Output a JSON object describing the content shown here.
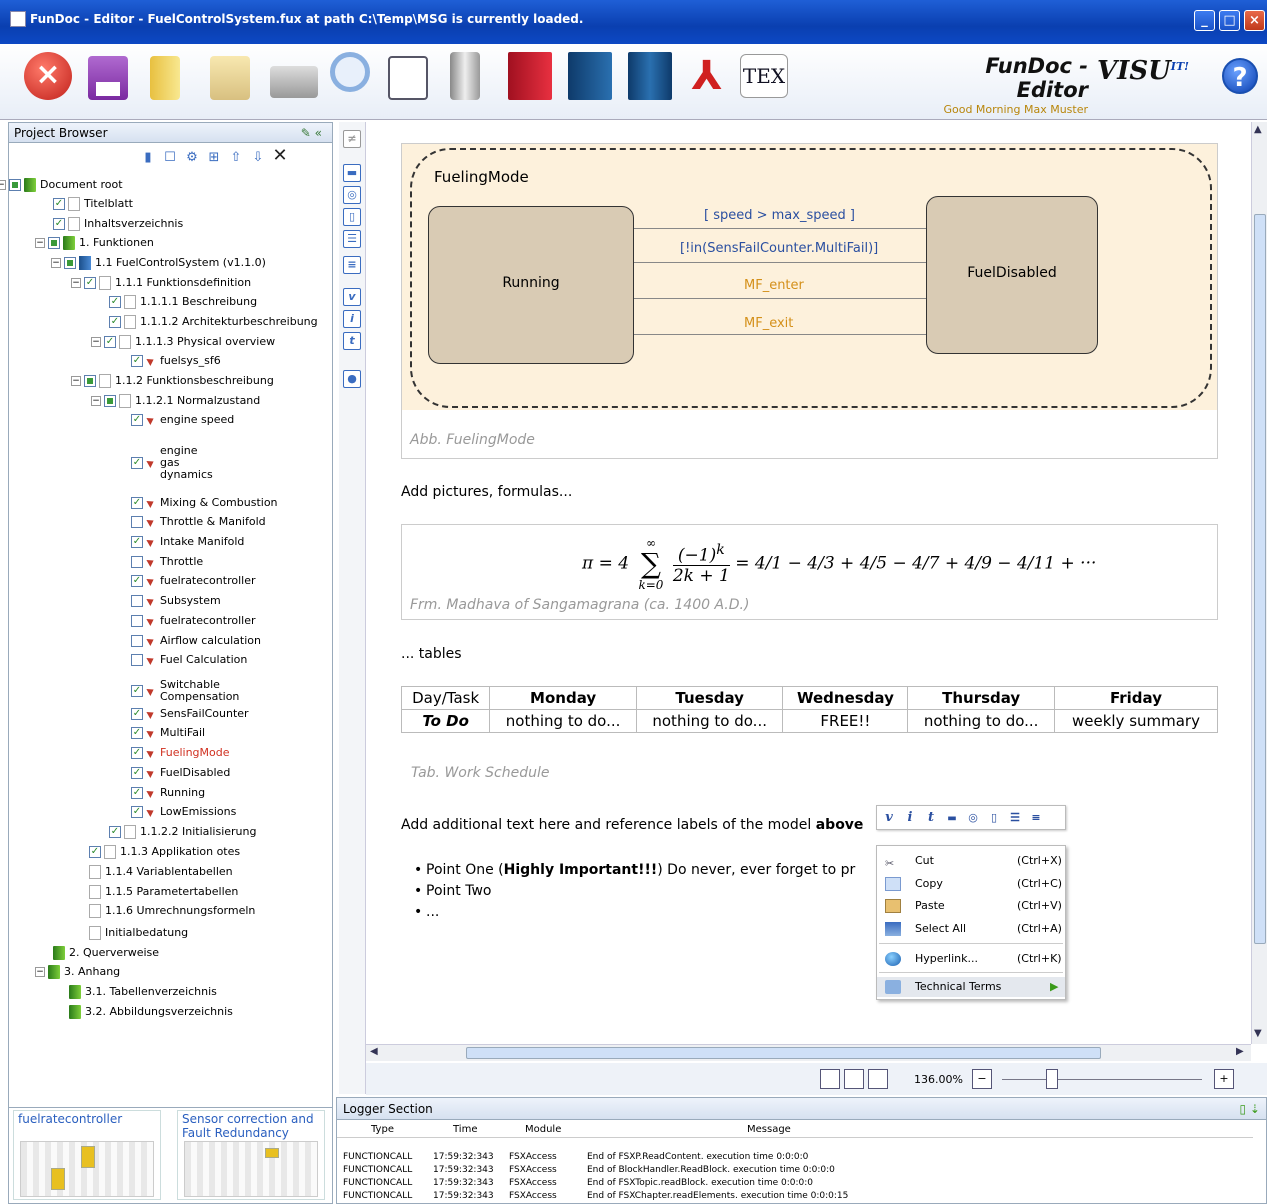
{
  "window": {
    "title": "FunDoc - Editor - FuelControlSystem.fux at path C:\\Temp\\MSG is currently loaded."
  },
  "brand": {
    "name": "FunDoc - Editor",
    "greeting": "Good Morning Max Muster",
    "logo": "VISU",
    "logo_suffix": "IT!"
  },
  "toolbar": {
    "icons": [
      "close-icon",
      "save-icon",
      "open-folder-icon",
      "copy-icon",
      "print-icon",
      "search-icon",
      "checklist-icon",
      "server-icon",
      "book-red-icon",
      "book-blue-icon",
      "books-icon",
      "pdf-icon",
      "tex-icon"
    ],
    "tex_label": "TEX"
  },
  "project_browser": {
    "title": "Project Browser",
    "tree": [
      {
        "label": "Document root",
        "level": 0
      },
      {
        "label": "Titelblatt",
        "level": 1
      },
      {
        "label": "Inhaltsverzeichnis",
        "level": 1
      },
      {
        "label": "1. Funktionen",
        "level": 1
      },
      {
        "label": "1.1 FuelControlSystem  (v1.1.0)",
        "level": 2
      },
      {
        "label": "1.1.1 Funktionsdefinition",
        "level": 3
      },
      {
        "label": "1.1.1.1 Beschreibung",
        "level": 4
      },
      {
        "label": "1.1.1.2 Architekturbeschreibung",
        "level": 4
      },
      {
        "label": "1.1.1.3 Physical overview",
        "level": 4
      },
      {
        "label": "fuelsys_sf6",
        "level": 5
      },
      {
        "label": "1.1.2 Funktionsbeschreibung",
        "level": 3
      },
      {
        "label": "1.1.2.1 Normalzustand",
        "level": 4
      },
      {
        "label": "engine speed",
        "level": 5
      },
      {
        "label": "engine gas dynamics",
        "level": 5
      },
      {
        "label": "Mixing & Combustion",
        "level": 5
      },
      {
        "label": "Throttle & Manifold",
        "level": 5
      },
      {
        "label": "Intake Manifold",
        "level": 5
      },
      {
        "label": "Throttle",
        "level": 5
      },
      {
        "label": "fuelratecontroller",
        "level": 5
      },
      {
        "label": "Subsystem",
        "level": 5
      },
      {
        "label": "fuelratecontroller",
        "level": 5
      },
      {
        "label": "Airflow calculation",
        "level": 5
      },
      {
        "label": "Fuel  Calculation",
        "level": 5
      },
      {
        "label": "Switchable Compensation",
        "level": 5
      },
      {
        "label": "SensFailCounter",
        "level": 5
      },
      {
        "label": "MultiFail",
        "level": 5
      },
      {
        "label": "FuelingMode",
        "level": 5,
        "selected": true
      },
      {
        "label": "FuelDisabled",
        "level": 5
      },
      {
        "label": "Running",
        "level": 5
      },
      {
        "label": "LowEmissions",
        "level": 5
      },
      {
        "label": "1.1.2.2 Initialisierung",
        "level": 4
      },
      {
        "label": "1.1.3 Applikation  otes",
        "level": 3
      },
      {
        "label": "1.1.4 Variablentabellen",
        "level": 3
      },
      {
        "label": "1.1.5 Parametertabellen",
        "level": 3
      },
      {
        "label": "1.1.6 Umrechnungsformeln",
        "level": 3
      },
      {
        "label": "Initialbedatung",
        "level": 3
      },
      {
        "label": "2. Querverweise",
        "level": 1
      },
      {
        "label": "3. Anhang",
        "level": 1
      },
      {
        "label": "3.1. Tabellenverzeichnis",
        "level": 2
      },
      {
        "label": "3.2. Abbildungsverzeichnis",
        "level": 2
      }
    ],
    "thumbnails": [
      "fuelratecontroller",
      "Sensor correction and Fault Redundancy"
    ]
  },
  "document": {
    "figure": {
      "chart_title": "FuelingMode",
      "states": [
        "Running",
        "FuelDisabled"
      ],
      "transitions": [
        "[ speed > max_speed ]",
        "[!in(SensFailCounter.MultiFail)]",
        "MF_enter",
        "MF_exit"
      ],
      "caption": "Abb. FuelingMode"
    },
    "add_pictures": "Add pictures, formulas...",
    "formula": {
      "lhs": "π = 4",
      "sum_top": "∞",
      "sum_bottom": "k=0",
      "frac_num": "(−1)",
      "frac_exp": "k",
      "frac_den": "2k + 1",
      "rhs": "= 4/1 − 4/3 + 4/5 − 4/7 + 4/9 − 4/11 + ···",
      "caption": "Frm. Madhava of Sangamagrana (ca. 1400 A.D.)"
    },
    "tables_text": "... tables",
    "table": {
      "headers": [
        "Day/Task",
        "Monday",
        "Tuesday",
        "Wednesday",
        "Thursday",
        "Friday"
      ],
      "row": [
        "To Do",
        "nothing to do...",
        "nothing to do...",
        "FREE!!",
        "nothing to do...",
        "weekly summary"
      ],
      "caption": "Tab. Work Schedule"
    },
    "add_text_pre": "Add additional text here and reference labels of the model ",
    "add_text_bold": "above",
    "bullets": [
      {
        "pre": "Point One (",
        "bold": "Highly Important!!!",
        "post": ") Do never, ever forget to pr"
      },
      {
        "pre": "Point Two",
        "bold": "",
        "post": ""
      },
      {
        "pre": "...",
        "bold": "",
        "post": ""
      }
    ]
  },
  "mini_toolbar": [
    "v",
    "i",
    "t"
  ],
  "context_menu": [
    {
      "label": "Cut",
      "shortcut": "(Ctrl+X)"
    },
    {
      "label": "Copy",
      "shortcut": "(Ctrl+C)"
    },
    {
      "label": "Paste",
      "shortcut": "(Ctrl+V)"
    },
    {
      "label": "Select All",
      "shortcut": "(Ctrl+A)"
    },
    {
      "label": "Hyperlink...",
      "shortcut": "(Ctrl+K)"
    },
    {
      "label": "Technical Terms",
      "shortcut": ""
    }
  ],
  "zoom": {
    "value": "136.00%"
  },
  "logger": {
    "title": "Logger Section",
    "columns": [
      "Type",
      "Time",
      "Module",
      "Message"
    ],
    "rows": [
      [
        "FUNCTIONCALL",
        "17:59:32:343",
        "FSXAccess",
        "End of FSXP.ReadContent. execution time 0:0:0:0"
      ],
      [
        "FUNCTIONCALL",
        "17:59:32:343",
        "FSXAccess",
        "End of BlockHandler.ReadBlock. execution time 0:0:0:0"
      ],
      [
        "FUNCTIONCALL",
        "17:59:32:343",
        "FSXAccess",
        "End of FSXTopic.readBlock. execution time 0:0:0:0"
      ],
      [
        "FUNCTIONCALL",
        "17:59:32:343",
        "FSXAccess",
        "End of FSXChapter.readElements. execution time 0:0:0:15"
      ]
    ]
  },
  "colors": {
    "titlebar": "#0a3fb0",
    "figure_bg": "#fdf1dc",
    "state_fill": "#d9cbb4",
    "transition_label": "#d4901a",
    "selected_tree": "#d03020"
  }
}
